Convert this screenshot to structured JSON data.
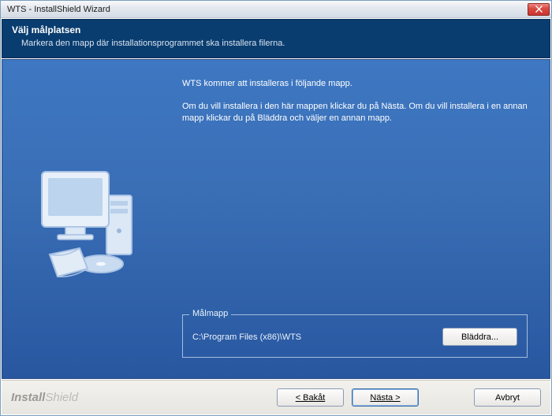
{
  "window": {
    "title": "WTS - InstallShield Wizard"
  },
  "banner": {
    "title": "Välj målplatsen",
    "subtitle": "Markera den mapp där installationsprogrammet ska installera filerna."
  },
  "content": {
    "line1": "WTS kommer att installeras i följande mapp.",
    "line2": "Om du vill installera i den här mappen klickar du på Nästa. Om du vill installera i en annan mapp klickar du på Bläddra och väljer en annan mapp."
  },
  "destination": {
    "legend": "Målmapp",
    "path": "C:\\Program Files (x86)\\WTS",
    "browse_label": "Bläddra..."
  },
  "footer": {
    "brand_bold": "Install",
    "brand_light": "Shield",
    "back_label": "< Bakåt",
    "next_label": "Nästa >",
    "cancel_label": "Avbryt"
  }
}
